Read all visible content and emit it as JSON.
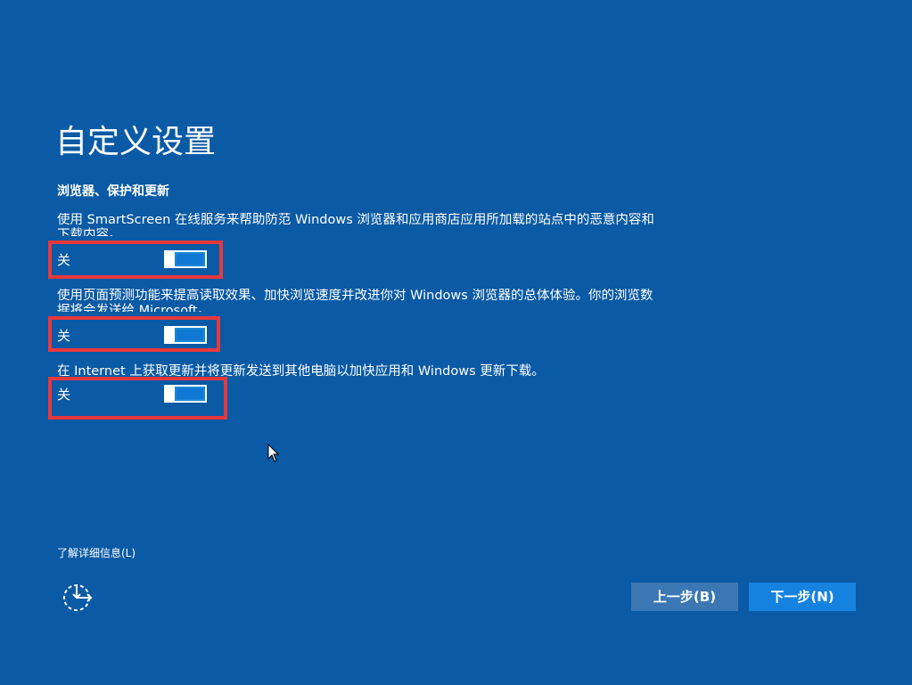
{
  "page": {
    "title": "自定义设置",
    "section_heading": "浏览器、保护和更新"
  },
  "settings": [
    {
      "description": "使用 SmartScreen 在线服务来帮助防范 Windows 浏览器和应用商店应用所加载的站点中的恶意内容和下载内容。",
      "toggle_label": "关",
      "state": "off"
    },
    {
      "description": "使用页面预测功能来提高读取效果、加快浏览速度并改进你对 Windows 浏览器的总体体验。你的浏览数据将会发送给 Microsoft。",
      "toggle_label": "关",
      "state": "off"
    },
    {
      "description": "在 Internet 上获取更新并将更新发送到其他电脑以加快应用和 Windows 更新下载。",
      "toggle_label": "关",
      "state": "off"
    }
  ],
  "footer": {
    "learn_more": "了解详细信息(L)",
    "back_button": "上一步(B)",
    "next_button": "下一步(N)",
    "ease_of_access_icon": "ease-of-access-icon"
  },
  "colors": {
    "background": "#0a5aa5",
    "highlight": "#e8383d",
    "toggle_fill": "#0f78d4",
    "next_button": "#1582df",
    "back_button": "#3b78b3"
  }
}
